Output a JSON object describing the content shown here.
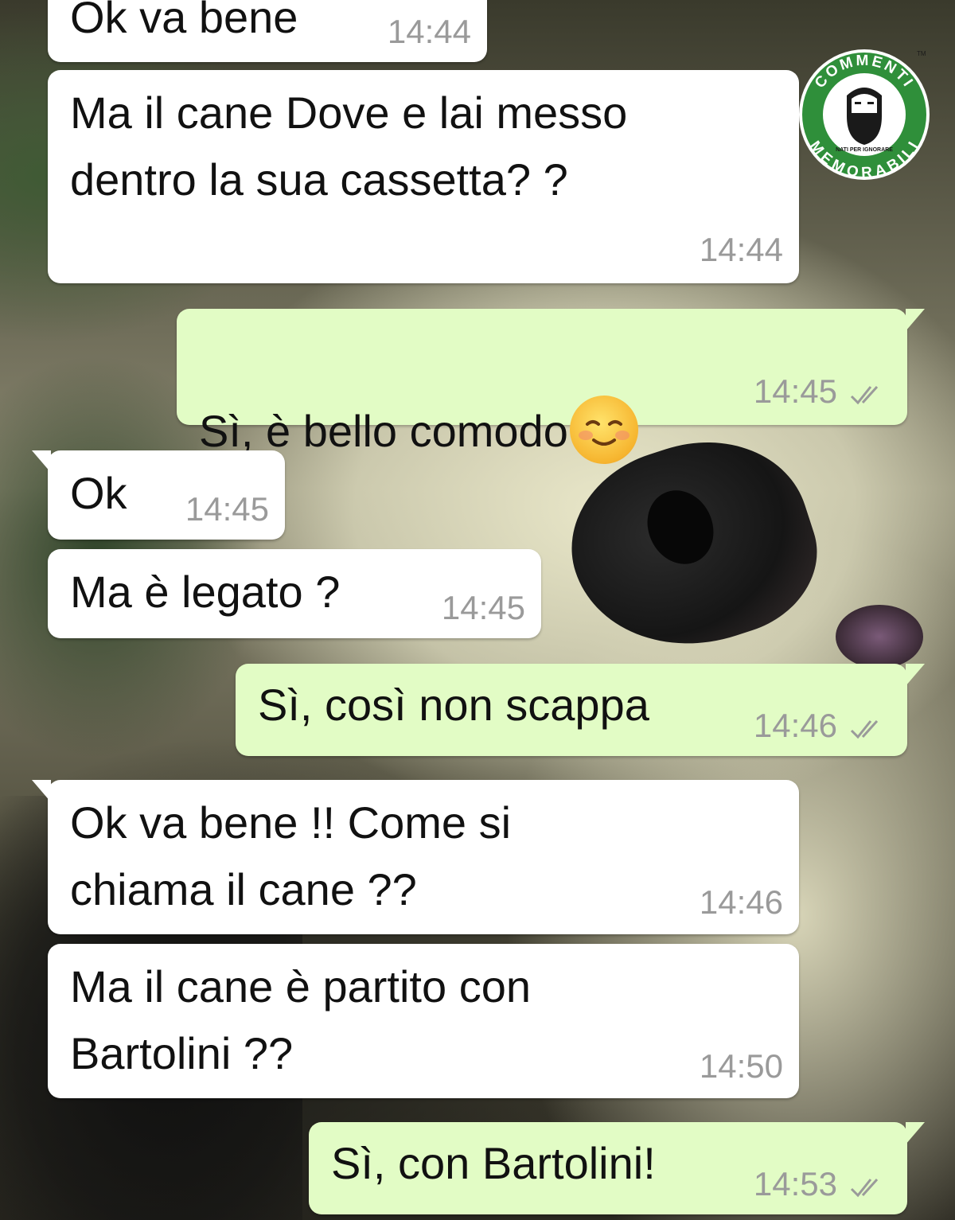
{
  "messages": [
    {
      "id": 1,
      "direction": "incoming",
      "text": "Ok va bene",
      "time": "14:44"
    },
    {
      "id": 2,
      "direction": "incoming",
      "text": "Ma il cane Dove e lai messo\ndentro la sua cassetta? ?",
      "time": "14:44"
    },
    {
      "id": 3,
      "direction": "outgoing",
      "text": "Sì, è bello comodo",
      "emoji": "smiling-face-icon",
      "time": "14:45",
      "status": "read"
    },
    {
      "id": 4,
      "direction": "incoming",
      "text": "Ok",
      "time": "14:45"
    },
    {
      "id": 5,
      "direction": "incoming",
      "text": "Ma è legato ?",
      "time": "14:45"
    },
    {
      "id": 6,
      "direction": "outgoing",
      "text": "Sì, così non scappa",
      "time": "14:46",
      "status": "read"
    },
    {
      "id": 7,
      "direction": "incoming",
      "text": "Ok va bene  !! Come si\nchiama il cane ??",
      "time": "14:46"
    },
    {
      "id": 8,
      "direction": "incoming",
      "text": "Ma il cane è partito con\nBartolini  ??",
      "time": "14:50"
    },
    {
      "id": 9,
      "direction": "outgoing",
      "text": "Sì, con Bartolini!",
      "time": "14:53",
      "status": "read"
    }
  ],
  "watermark": {
    "top_text": "COMMENTI",
    "bottom_text": "MEMORABILI",
    "tagline": "NATI PER IGNORARE",
    "mark": "TM"
  },
  "colors": {
    "incoming_bubble": "#ffffff",
    "outgoing_bubble": "#e2fcc5",
    "timestamp": "#9a9a9a",
    "logo_green": "#2f8f3a"
  }
}
